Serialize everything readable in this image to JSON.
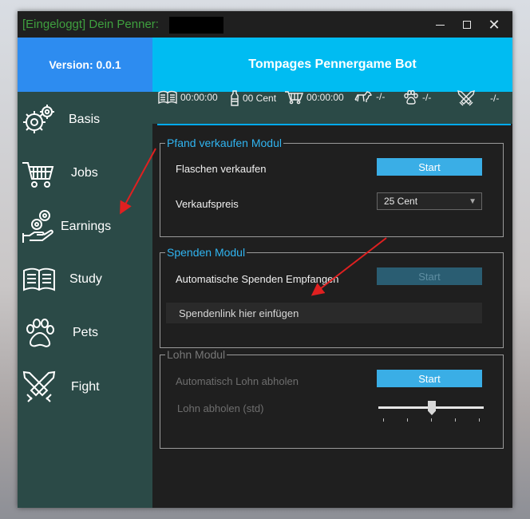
{
  "window": {
    "title": "[Eingeloggt] Dein Penner:",
    "minimize_icon": "minimize-icon",
    "maximize_icon": "maximize-icon",
    "close_icon": "close-icon"
  },
  "header": {
    "version": "Version: 0.0.1",
    "app_title": "Tompages Pennergame Bot"
  },
  "sidebar": {
    "items": [
      {
        "label": "Basis",
        "icon": "gears-icon"
      },
      {
        "label": "Jobs",
        "icon": "shopping-cart-icon"
      },
      {
        "label": "Earnings",
        "icon": "coins-hand-icon"
      },
      {
        "label": "Study",
        "icon": "open-book-icon"
      },
      {
        "label": "Pets",
        "icon": "paw-icon"
      },
      {
        "label": "Fight",
        "icon": "crossed-swords-icon"
      }
    ]
  },
  "statusbar": {
    "study_time": "00:00:00",
    "bottle_cent": "00 Cent",
    "cart_time": "00:00:00",
    "pet_value": "-/-",
    "paw_value": "-/-",
    "fight_value": "-/-"
  },
  "pfand": {
    "title": "Pfand verkaufen Modul",
    "sell_label": "Flaschen verkaufen",
    "start_label": "Start",
    "price_label": "Verkaufspreis",
    "price_value": "25 Cent"
  },
  "spenden": {
    "title": "Spenden Modul",
    "auto_label": "Automatische Spenden Empfangen",
    "start_label": "Start",
    "link_placeholder": "Spendenlink hier einfügen"
  },
  "lohn": {
    "title": "Lohn Modul",
    "auto_label": "Automatisch Lohn abholen",
    "start_label": "Start",
    "interval_label": "Lohn abholen (std)"
  },
  "colors": {
    "title_green": "#3fa03f",
    "accent_blue": "#00bcf2",
    "version_blue": "#2d8cf0",
    "sidebar_teal": "#2b4a47",
    "group_title_blue": "#30b4f0",
    "button_blue": "#3aaee6",
    "arrow_red": "#e02020"
  }
}
